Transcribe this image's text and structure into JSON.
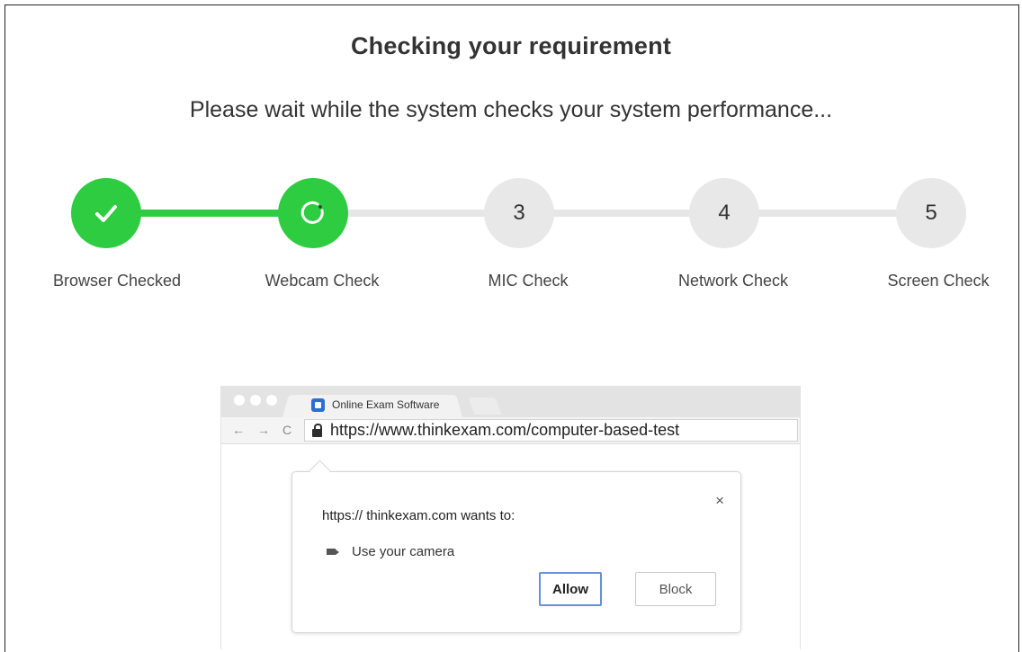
{
  "header": {
    "title": "Checking your requirement",
    "subtitle": "Please wait while the system checks your system performance..."
  },
  "steps": [
    {
      "label": "Browser Checked",
      "state": "done",
      "icon": "check-icon",
      "number": ""
    },
    {
      "label": "Webcam Check",
      "state": "in-progress",
      "icon": "loading-spinner-icon",
      "number": ""
    },
    {
      "label": "MIC Check",
      "state": "pending",
      "icon": "",
      "number": "3"
    },
    {
      "label": "Network Check",
      "state": "pending",
      "icon": "",
      "number": "4"
    },
    {
      "label": "Screen Check",
      "state": "pending",
      "icon": "",
      "number": "5"
    }
  ],
  "colors": {
    "done": "#2ecc40",
    "pending": "#e8e8e8"
  },
  "browser_mockup": {
    "tab_title": "Online Exam Software",
    "url": "https://www.thinkexam.com/computer-based-test",
    "popup": {
      "message": "https:// thinkexam.com wants to:",
      "permission": "Use your camera",
      "close_label": "×",
      "allow_label": "Allow",
      "block_label": "Block"
    }
  }
}
